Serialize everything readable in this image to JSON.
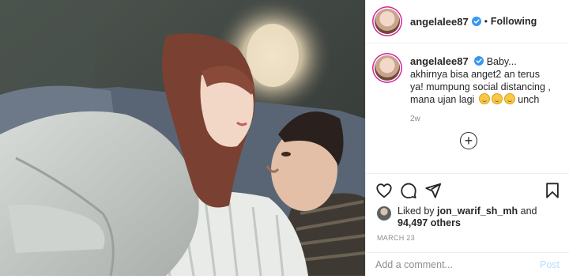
{
  "post": {
    "photo_alt": "",
    "author": "angelalee87",
    "verified": true,
    "follow_status": "Following",
    "separator": "•"
  },
  "caption": {
    "username": "angelalee87",
    "text": "Baby... akhirnya bisa anget2 an terus ya! mumpung social distancing , mana ujan lagi",
    "trailing": "unch",
    "emoji_count": 3,
    "time_ago": "2w"
  },
  "actions": {
    "liked_by_prefix": "Liked by ",
    "liked_by_user": "jon_warif_sh_mh",
    "liked_by_and": " and",
    "likes_count": "94,497 others",
    "date": "MARCH 23"
  },
  "comment_box": {
    "placeholder": "Add a comment...",
    "post_label": "Post"
  },
  "icons": [
    "heart-icon",
    "comment-icon",
    "share-icon",
    "bookmark-icon",
    "plus-circle-icon",
    "verified-badge-icon"
  ],
  "colors": {
    "verified_blue": "#3897f0",
    "post_disabled": "#b2dffc",
    "muted_text": "#8e8e8e"
  }
}
